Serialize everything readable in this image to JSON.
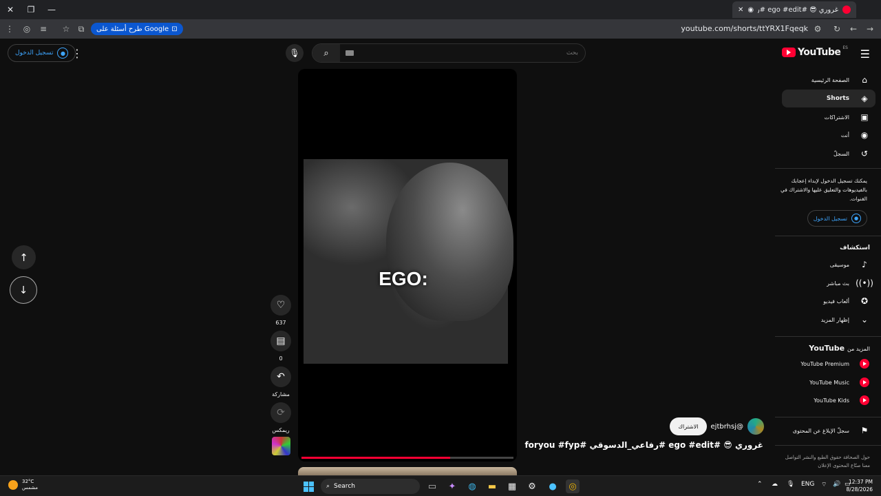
{
  "browser": {
    "tab_title": "غروري 😎 #ego #edit #رفا...",
    "url": "youtube.com/shorts/ttYRX1Fqeqk",
    "google_chip": "طرح أسئلة على Google"
  },
  "header": {
    "signin_label": "تسجيل الدخول",
    "search_placeholder": "بحث",
    "logo_text": "YouTube",
    "logo_country": "ES"
  },
  "short": {
    "caption_text": "EGO:",
    "progress": 0.7,
    "actions": {
      "like_count": "637",
      "comment_count": "0",
      "share_label": "مشاركة",
      "remix_label": "ريمكس"
    },
    "channel_handle": "@ejtbrhsj",
    "subscribe_label": "الاشتراك",
    "title": "غروري 😎 #ego #edit #رفاعي_الدسوقي #foryou #fyp"
  },
  "sidebar": {
    "nav": [
      {
        "label": "الصفحة الرئيسية",
        "icon": "home-icon"
      },
      {
        "label": "Shorts",
        "icon": "shorts-icon"
      },
      {
        "label": "الاشتراكات",
        "icon": "subscriptions-icon"
      },
      {
        "label": "أنت",
        "icon": "you-icon"
      },
      {
        "label": "السجلّ",
        "icon": "history-icon"
      }
    ],
    "signin_prompt": "يمكنك تسجيل الدخول لإبداء إعجابك بالفيديوهات والتعليق عليها والاشتراك في القنوات.",
    "signin_label": "تسجيل الدخول",
    "explore_title": "استكشاف",
    "explore": [
      {
        "label": "موسيقى",
        "icon": "music-icon"
      },
      {
        "label": "بث مباشر",
        "icon": "live-icon"
      },
      {
        "label": "ألعاب فيديو",
        "icon": "gaming-icon"
      },
      {
        "label": "إظهار المزيد",
        "icon": "chevron-down-icon"
      }
    ],
    "more_title_prefix": "المزيد من",
    "more_title_brand": "YouTube",
    "more": [
      {
        "label": "YouTube Premium",
        "icon": "youtube-premium-icon"
      },
      {
        "label": "YouTube Music",
        "icon": "youtube-music-icon"
      },
      {
        "label": "YouTube Kids",
        "icon": "youtube-kids-icon"
      }
    ],
    "report_label": "سجلّ الإبلاغ عن المحتوى",
    "footer_links": "حول  الصحافة  حقوق الطبع والنشر  التواصل معنا  صنّاع المحتوى  الإعلان"
  },
  "taskbar": {
    "temperature": "32°C",
    "weather": "مشمس",
    "search_label": "Search",
    "language": "ENG",
    "time": "12:37 PM",
    "date": "8/28/2026"
  },
  "colors": {
    "accent_red": "#ff0033",
    "link_blue": "#3ea6ff",
    "background": "#0f0f0f"
  }
}
